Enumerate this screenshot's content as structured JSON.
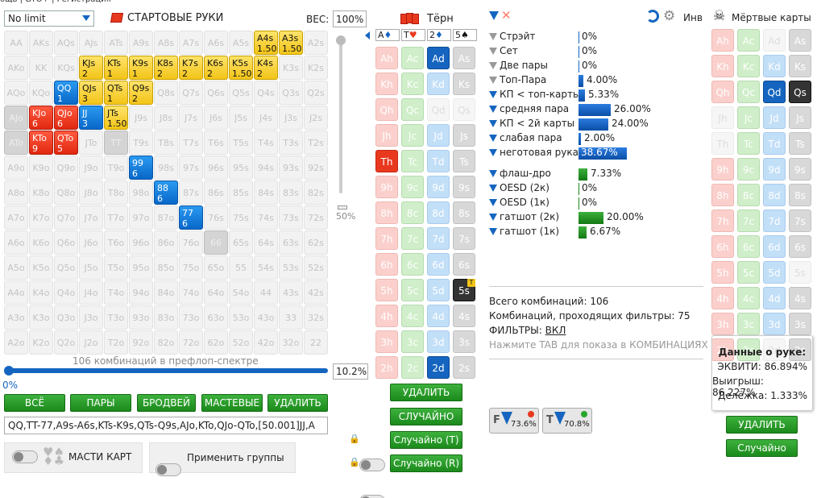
{
  "top_strip": "ощь   |   GTO+   |   Регистрация",
  "game_select": "No limit",
  "start_hands": "СТАРТОВЫЕ РУКИ",
  "weight_label": "ВЕС:",
  "weight_value": "100%",
  "scroll_pct": "50%",
  "combos_text": "106 комбинаций в префлоп-спектре",
  "range_pct": "10.2%",
  "range_zero": "0%",
  "buttons": {
    "all": "ВСЁ",
    "pairs": "ПАРЫ",
    "broadway": "БРОДВЕЙ",
    "suited": "МАСТЕВЫЕ",
    "delete": "УДАЛИТЬ"
  },
  "range_text": "QQ,TT-77,A9s-A6s,KTs-K9s,QTs-Q9s,AJo,KTo,QJo-QTo,[50.001]JJ,A",
  "suit_toggle_label": "МАСТИ КАРТ",
  "groups_toggle_label": "Применить группы",
  "turn_title": "Тёрн",
  "board": [
    {
      "rank": "A",
      "suit": "♦"
    },
    {
      "rank": "T",
      "suit": "♥"
    },
    {
      "rank": "2",
      "suit": "♦"
    },
    {
      "rank": "5",
      "suit": "♠"
    }
  ],
  "turn_buttons": {
    "delete": "УДАЛИТЬ",
    "random": "СЛУЧАЙНО",
    "random_t": "Случайно (T)",
    "random_r": "Случайно (R)"
  },
  "dead_title": "Мёртвые карты",
  "inv_label": "Инв",
  "dead_buttons": {
    "delete": "УДАЛИТЬ",
    "random": "Случайно"
  },
  "stats": [
    {
      "label": "Стрэйт",
      "value": "0%",
      "v": 0,
      "blue": false
    },
    {
      "label": "Сет",
      "value": "0%",
      "v": 0,
      "blue": false
    },
    {
      "label": "Две пары",
      "value": "0%",
      "v": 0,
      "blue": false
    },
    {
      "label": "Топ-Пара",
      "value": "4.00%",
      "v": 4.0,
      "blue": false
    },
    {
      "label": "КП < топ-карты",
      "value": "5.33%",
      "v": 5.33,
      "blue": true
    },
    {
      "label": "средняя пара",
      "value": "26.00%",
      "v": 26.0,
      "blue": true
    },
    {
      "label": "КП < 2й карты",
      "value": "24.00%",
      "v": 24.0,
      "blue": true
    },
    {
      "label": "слабая пара",
      "value": "2.00%",
      "v": 2.0,
      "blue": true
    },
    {
      "label": "неготовая рука",
      "value": "38.67%",
      "v": 38.67,
      "blue": true
    }
  ],
  "draws": [
    {
      "label": "флаш-дро",
      "value": "7.33%",
      "v": 7.33
    },
    {
      "label": "OESD (2к)",
      "value": "0%",
      "v": 0
    },
    {
      "label": "OESD (1к)",
      "value": "0%",
      "v": 0
    },
    {
      "label": "гатшот (2к)",
      "value": "20.00%",
      "v": 20.0
    },
    {
      "label": "гатшот (1к)",
      "value": "6.67%",
      "v": 6.67
    }
  ],
  "summary": {
    "total": "Всего комбинаций: 106",
    "passing": "Комбинаций, проходящих фильтры: 75",
    "filters_label": "ФИЛЬТРЫ:",
    "filters_value": "ВКЛ",
    "tab_hint": "Нажмите TAB для показа в КОМБИНАЦИЯХ"
  },
  "filter_badges": {
    "f": "73.6%",
    "t": "70.8%"
  },
  "hand_data": {
    "title": "Данные о руке:",
    "equity": "ЭКВИТИ: 86.894%",
    "win": "Выигрыш: 86.227%",
    "tie": "Делёжка: 1.333%"
  },
  "colors": {
    "green": "#1b8a1b",
    "blue": "#1565c0",
    "red": "#e8391f",
    "yellow": "#f2c417"
  }
}
